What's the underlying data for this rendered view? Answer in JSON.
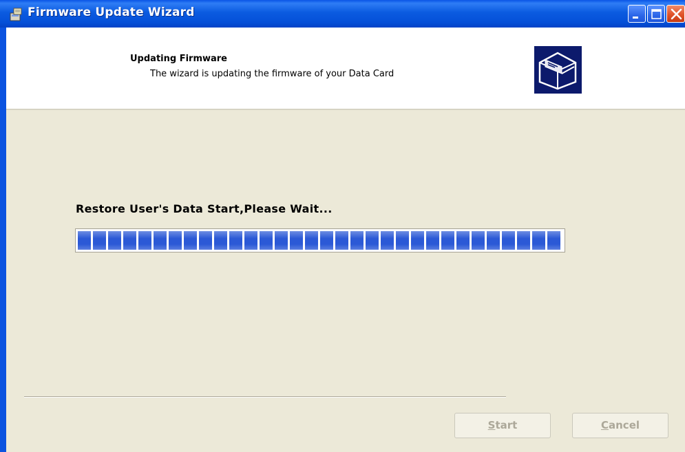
{
  "window": {
    "title": "Firmware Update Wizard",
    "icons": {
      "app": "installer-icon",
      "minimize": "minimize-icon",
      "maximize": "maximize-icon",
      "close": "close-icon"
    }
  },
  "header": {
    "title": "Updating Firmware",
    "subtitle": "The wizard is updating the firmware of your Data Card",
    "image_icon": "hardware-box-icon"
  },
  "main": {
    "status": "Restore User's Data Start,Please Wait...",
    "progress_percent": 100
  },
  "buttons": {
    "start": {
      "label": "Start",
      "enabled": false
    },
    "cancel": {
      "label": "Cancel",
      "enabled": false
    }
  },
  "colors": {
    "titlebar": "#0550d8",
    "progress": "#2b59d6",
    "background": "#ece9d8"
  }
}
